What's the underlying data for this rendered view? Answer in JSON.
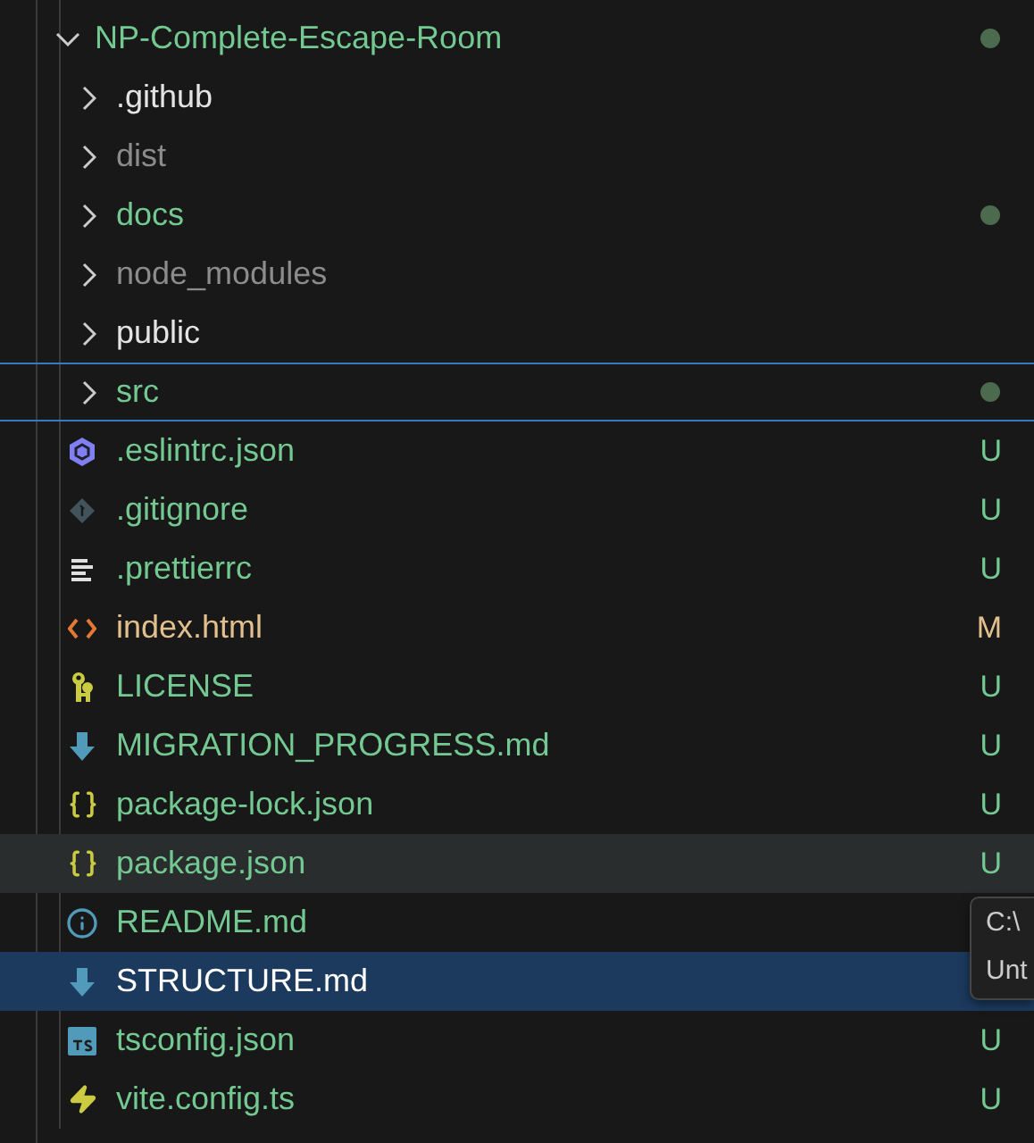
{
  "explorer": {
    "root": {
      "name": "NP-Complete-Escape-Room",
      "expanded": true,
      "color": "#73c991",
      "dot": true,
      "children": [
        {
          "kind": "folder",
          "name": ".github",
          "expanded": false,
          "color": "#e4e4e4",
          "dot": false,
          "outlined": false
        },
        {
          "kind": "folder",
          "name": "dist",
          "expanded": false,
          "color": "#8c8c8c",
          "dot": false,
          "outlined": false
        },
        {
          "kind": "folder",
          "name": "docs",
          "expanded": false,
          "color": "#73c991",
          "dot": true,
          "outlined": false
        },
        {
          "kind": "folder",
          "name": "node_modules",
          "expanded": false,
          "color": "#8c8c8c",
          "dot": false,
          "outlined": false
        },
        {
          "kind": "folder",
          "name": "public",
          "expanded": false,
          "color": "#e4e4e4",
          "dot": false,
          "outlined": false
        },
        {
          "kind": "folder",
          "name": "src",
          "expanded": false,
          "color": "#73c991",
          "dot": true,
          "outlined": true
        },
        {
          "kind": "eslint",
          "name": ".eslintrc.json",
          "color": "#73c991",
          "badge": "U",
          "selected": false,
          "hovered": false
        },
        {
          "kind": "git",
          "name": ".gitignore",
          "color": "#73c991",
          "badge": "U",
          "selected": false,
          "hovered": false
        },
        {
          "kind": "lines",
          "name": ".prettierrc",
          "color": "#73c991",
          "badge": "U",
          "selected": false,
          "hovered": false
        },
        {
          "kind": "html",
          "name": "index.html",
          "color": "#e2c08d",
          "badge": "M",
          "selected": false,
          "hovered": false
        },
        {
          "kind": "license",
          "name": "LICENSE",
          "color": "#73c991",
          "badge": "U",
          "selected": false,
          "hovered": false
        },
        {
          "kind": "markdown",
          "name": "MIGRATION_PROGRESS.md",
          "color": "#73c991",
          "badge": "U",
          "selected": false,
          "hovered": false
        },
        {
          "kind": "json",
          "name": "package-lock.json",
          "color": "#73c991",
          "badge": "U",
          "selected": false,
          "hovered": false
        },
        {
          "kind": "json",
          "name": "package.json",
          "color": "#73c991",
          "badge": "U",
          "selected": false,
          "hovered": true
        },
        {
          "kind": "info",
          "name": "README.md",
          "color": "#73c991",
          "selected": false,
          "hovered": false
        },
        {
          "kind": "markdown",
          "name": "STRUCTURE.md",
          "color": "#ffffff",
          "selected": true,
          "hovered": false
        },
        {
          "kind": "typescript",
          "name": "tsconfig.json",
          "color": "#73c991",
          "badge": "U",
          "selected": false,
          "hovered": false
        },
        {
          "kind": "vite",
          "name": "vite.config.ts",
          "color": "#73c991",
          "badge": "U",
          "selected": false,
          "hovered": false
        }
      ]
    }
  },
  "tooltip": {
    "lines": [
      "C:\\",
      "Unt"
    ]
  }
}
